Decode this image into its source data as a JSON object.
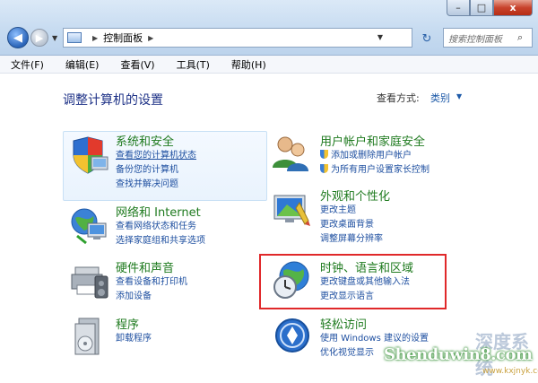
{
  "window": {
    "caption": {
      "minimize": "–",
      "maximize": "□",
      "close": "x"
    }
  },
  "navbar": {
    "back_glyph": "◀",
    "forward_glyph": "▶",
    "address_path": "控制面板",
    "refresh_glyph": "↻",
    "search_placeholder": "搜索控制面板"
  },
  "menubar": {
    "items": [
      "文件(F)",
      "编辑(E)",
      "查看(V)",
      "工具(T)",
      "帮助(H)"
    ]
  },
  "content": {
    "heading": "调整计算机的设置",
    "view_by_label": "查看方式:",
    "view_by_value": "类别",
    "categories": [
      {
        "title": "系统和安全",
        "links": [
          "查看您的计算机状态",
          "备份您的计算机",
          "查找并解决问题"
        ]
      },
      {
        "title": "网络和 Internet",
        "links": [
          "查看网络状态和任务",
          "选择家庭组和共享选项"
        ]
      },
      {
        "title": "硬件和声音",
        "links": [
          "查看设备和打印机",
          "添加设备"
        ]
      },
      {
        "title": "程序",
        "links": [
          "卸载程序"
        ]
      },
      {
        "title": "用户帐户和家庭安全",
        "links": [
          "添加或删除用户帐户",
          "为所有用户设置家长控制"
        ]
      },
      {
        "title": "外观和个性化",
        "links": [
          "更改主题",
          "更改桌面背景",
          "调整屏幕分辨率"
        ]
      },
      {
        "title": "时钟、语言和区域",
        "links": [
          "更改键盘或其他输入法",
          "更改显示语言"
        ]
      },
      {
        "title": "轻松访问",
        "links": [
          "使用 Windows 建议的设置",
          "优化视觉显示"
        ]
      }
    ]
  },
  "watermark": {
    "text": "Shenduwin8.com",
    "site_cn": "深度系统",
    "url": "www.kxjnyk.com"
  },
  "colors": {
    "category_title": "#1e7a1e",
    "link": "#1e4fa0",
    "heading": "#1e3287",
    "highlight_border": "#e0282a"
  }
}
